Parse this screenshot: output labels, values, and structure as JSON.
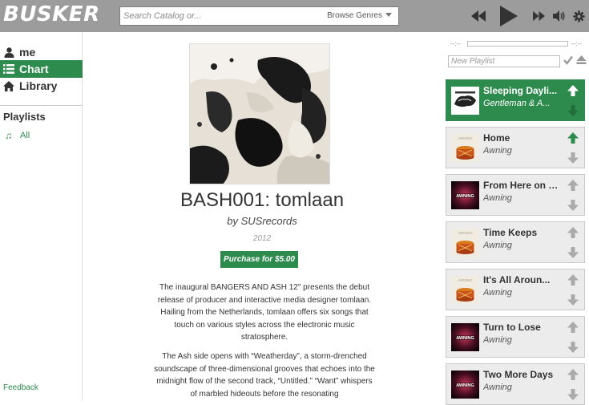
{
  "app": {
    "name": "BUSKER"
  },
  "search": {
    "placeholder": "Search Catalog or...",
    "browse_label": "Browse Genres"
  },
  "player": {
    "time_elapsed": "--:--",
    "time_total": "--:--",
    "progress": 0
  },
  "nav": {
    "items": [
      {
        "label": "me",
        "icon": "user-icon",
        "active": false
      },
      {
        "label": "Chart",
        "icon": "list-icon",
        "active": true
      },
      {
        "label": "Library",
        "icon": "home-icon",
        "active": false
      }
    ],
    "playlists_heading": "Playlists",
    "playlists": [
      {
        "label": "All",
        "icon": "music-note-icon"
      }
    ],
    "feedback": "Feedback"
  },
  "album": {
    "title": "BASH001: tomlaan",
    "artist": "by SUSrecords",
    "year": "2012",
    "purchase_label": "Purchase for $5.00",
    "description": [
      "The inaugural BANGERS AND ASH 12\" presents the debut release of producer and interactive media designer tomlaan. Hailing from the Netherlands, tomlaan offers six songs that touch on various styles across the electronic music stratosphere.",
      "The Ash side opens with “Weatherday”, a storm-drenched soundscape of three-dimensional grooves that echoes into the midnight flow of the second track, “Untitled.” “Want” whispers of marbled hideouts before the resonating"
    ]
  },
  "queue": {
    "new_playlist_placeholder": "New Playlist",
    "tracks": [
      {
        "title": "Sleeping Dayli...",
        "artist": "Gentleman & A...",
        "playing": true,
        "up_voted": true,
        "art": "gentleman"
      },
      {
        "title": "Home",
        "artist": "Awning",
        "playing": false,
        "up_voted": true,
        "art": "drum"
      },
      {
        "title": "From Here on t...",
        "artist": "Awning",
        "playing": false,
        "up_voted": false,
        "art": "awning-dark"
      },
      {
        "title": "Time Keeps",
        "artist": "Awning",
        "playing": false,
        "up_voted": false,
        "art": "drum"
      },
      {
        "title": "It's All Aroun...",
        "artist": "Awning",
        "playing": false,
        "up_voted": false,
        "art": "drum"
      },
      {
        "title": "Turn to Lose",
        "artist": "Awning",
        "playing": false,
        "up_voted": false,
        "art": "awning-dark"
      },
      {
        "title": "Two More Days",
        "artist": "Awning",
        "playing": false,
        "up_voted": false,
        "art": "awning-dark"
      }
    ]
  },
  "colors": {
    "accent": "#2e8b4e",
    "topbar": "#9c9c9c",
    "track_bg": "#ececec"
  }
}
